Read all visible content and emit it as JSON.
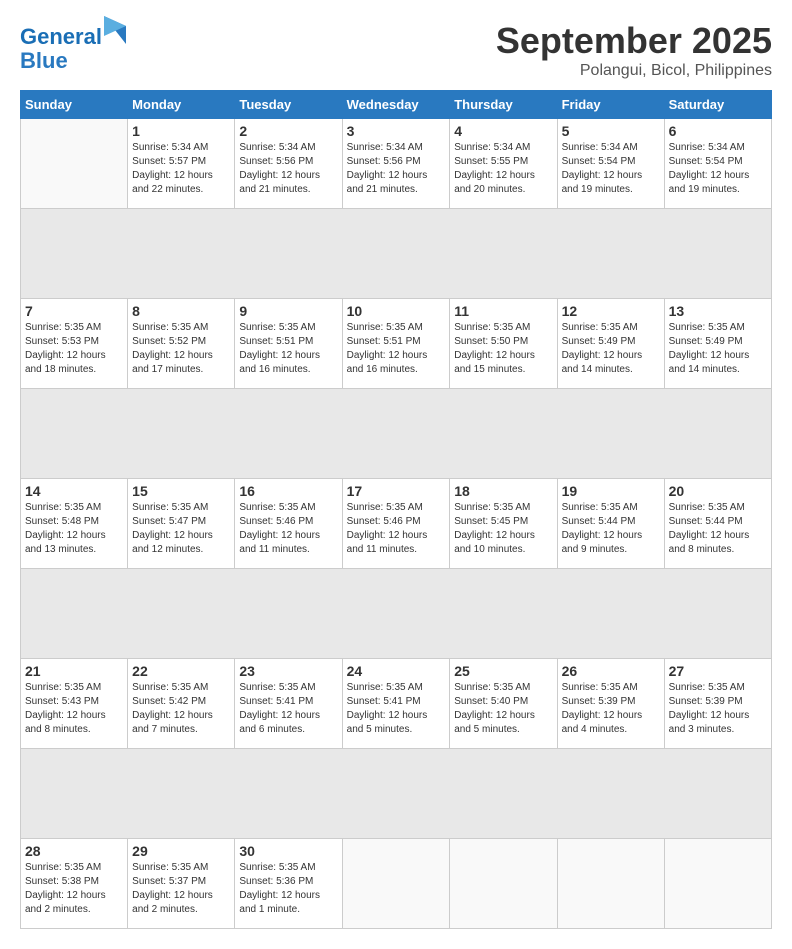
{
  "logo": {
    "line1": "General",
    "line2": "Blue"
  },
  "title": "September 2025",
  "subtitle": "Polangui, Bicol, Philippines",
  "days_of_week": [
    "Sunday",
    "Monday",
    "Tuesday",
    "Wednesday",
    "Thursday",
    "Friday",
    "Saturday"
  ],
  "weeks": [
    [
      {
        "day": "",
        "info": ""
      },
      {
        "day": "1",
        "info": "Sunrise: 5:34 AM\nSunset: 5:57 PM\nDaylight: 12 hours\nand 22 minutes."
      },
      {
        "day": "2",
        "info": "Sunrise: 5:34 AM\nSunset: 5:56 PM\nDaylight: 12 hours\nand 21 minutes."
      },
      {
        "day": "3",
        "info": "Sunrise: 5:34 AM\nSunset: 5:56 PM\nDaylight: 12 hours\nand 21 minutes."
      },
      {
        "day": "4",
        "info": "Sunrise: 5:34 AM\nSunset: 5:55 PM\nDaylight: 12 hours\nand 20 minutes."
      },
      {
        "day": "5",
        "info": "Sunrise: 5:34 AM\nSunset: 5:54 PM\nDaylight: 12 hours\nand 19 minutes."
      },
      {
        "day": "6",
        "info": "Sunrise: 5:34 AM\nSunset: 5:54 PM\nDaylight: 12 hours\nand 19 minutes."
      }
    ],
    [
      {
        "day": "7",
        "info": "Sunrise: 5:35 AM\nSunset: 5:53 PM\nDaylight: 12 hours\nand 18 minutes."
      },
      {
        "day": "8",
        "info": "Sunrise: 5:35 AM\nSunset: 5:52 PM\nDaylight: 12 hours\nand 17 minutes."
      },
      {
        "day": "9",
        "info": "Sunrise: 5:35 AM\nSunset: 5:51 PM\nDaylight: 12 hours\nand 16 minutes."
      },
      {
        "day": "10",
        "info": "Sunrise: 5:35 AM\nSunset: 5:51 PM\nDaylight: 12 hours\nand 16 minutes."
      },
      {
        "day": "11",
        "info": "Sunrise: 5:35 AM\nSunset: 5:50 PM\nDaylight: 12 hours\nand 15 minutes."
      },
      {
        "day": "12",
        "info": "Sunrise: 5:35 AM\nSunset: 5:49 PM\nDaylight: 12 hours\nand 14 minutes."
      },
      {
        "day": "13",
        "info": "Sunrise: 5:35 AM\nSunset: 5:49 PM\nDaylight: 12 hours\nand 14 minutes."
      }
    ],
    [
      {
        "day": "14",
        "info": "Sunrise: 5:35 AM\nSunset: 5:48 PM\nDaylight: 12 hours\nand 13 minutes."
      },
      {
        "day": "15",
        "info": "Sunrise: 5:35 AM\nSunset: 5:47 PM\nDaylight: 12 hours\nand 12 minutes."
      },
      {
        "day": "16",
        "info": "Sunrise: 5:35 AM\nSunset: 5:46 PM\nDaylight: 12 hours\nand 11 minutes."
      },
      {
        "day": "17",
        "info": "Sunrise: 5:35 AM\nSunset: 5:46 PM\nDaylight: 12 hours\nand 11 minutes."
      },
      {
        "day": "18",
        "info": "Sunrise: 5:35 AM\nSunset: 5:45 PM\nDaylight: 12 hours\nand 10 minutes."
      },
      {
        "day": "19",
        "info": "Sunrise: 5:35 AM\nSunset: 5:44 PM\nDaylight: 12 hours\nand 9 minutes."
      },
      {
        "day": "20",
        "info": "Sunrise: 5:35 AM\nSunset: 5:44 PM\nDaylight: 12 hours\nand 8 minutes."
      }
    ],
    [
      {
        "day": "21",
        "info": "Sunrise: 5:35 AM\nSunset: 5:43 PM\nDaylight: 12 hours\nand 8 minutes."
      },
      {
        "day": "22",
        "info": "Sunrise: 5:35 AM\nSunset: 5:42 PM\nDaylight: 12 hours\nand 7 minutes."
      },
      {
        "day": "23",
        "info": "Sunrise: 5:35 AM\nSunset: 5:41 PM\nDaylight: 12 hours\nand 6 minutes."
      },
      {
        "day": "24",
        "info": "Sunrise: 5:35 AM\nSunset: 5:41 PM\nDaylight: 12 hours\nand 5 minutes."
      },
      {
        "day": "25",
        "info": "Sunrise: 5:35 AM\nSunset: 5:40 PM\nDaylight: 12 hours\nand 5 minutes."
      },
      {
        "day": "26",
        "info": "Sunrise: 5:35 AM\nSunset: 5:39 PM\nDaylight: 12 hours\nand 4 minutes."
      },
      {
        "day": "27",
        "info": "Sunrise: 5:35 AM\nSunset: 5:39 PM\nDaylight: 12 hours\nand 3 minutes."
      }
    ],
    [
      {
        "day": "28",
        "info": "Sunrise: 5:35 AM\nSunset: 5:38 PM\nDaylight: 12 hours\nand 2 minutes."
      },
      {
        "day": "29",
        "info": "Sunrise: 5:35 AM\nSunset: 5:37 PM\nDaylight: 12 hours\nand 2 minutes."
      },
      {
        "day": "30",
        "info": "Sunrise: 5:35 AM\nSunset: 5:36 PM\nDaylight: 12 hours\nand 1 minute."
      },
      {
        "day": "",
        "info": ""
      },
      {
        "day": "",
        "info": ""
      },
      {
        "day": "",
        "info": ""
      },
      {
        "day": "",
        "info": ""
      }
    ]
  ]
}
